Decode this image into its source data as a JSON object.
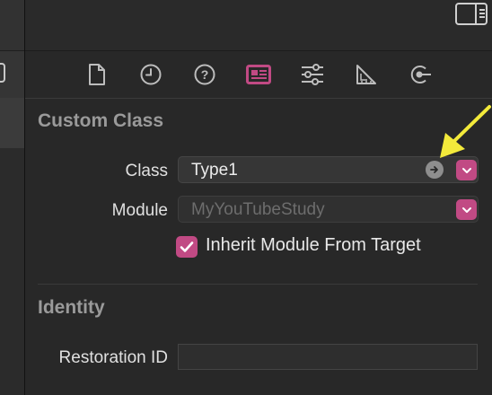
{
  "inspector": {
    "tabs": [
      {
        "icon": "file-inspector-icon"
      },
      {
        "icon": "history-inspector-icon"
      },
      {
        "icon": "quick-help-icon"
      },
      {
        "icon": "identity-inspector-icon",
        "active": true
      },
      {
        "icon": "attributes-inspector-icon"
      },
      {
        "icon": "size-inspector-icon"
      },
      {
        "icon": "connections-inspector-icon"
      }
    ],
    "custom_class": {
      "title": "Custom Class",
      "class_label": "Class",
      "class_value": "Type1",
      "module_label": "Module",
      "module_placeholder": "MyYouTubeStudy",
      "inherit_label": "Inherit Module From Target",
      "inherit_checked": true
    },
    "identity": {
      "title": "Identity",
      "restoration_label": "Restoration ID",
      "restoration_value": ""
    }
  },
  "colors": {
    "accent": "#c14a84",
    "annotation_arrow": "#f3ea3b",
    "background": "#282828"
  }
}
